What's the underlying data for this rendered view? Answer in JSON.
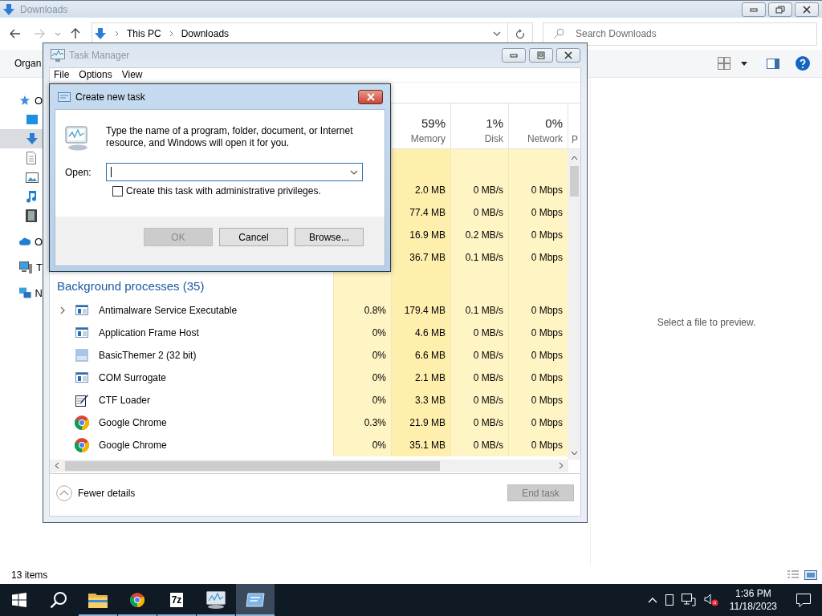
{
  "explorer": {
    "title": "Downloads",
    "path": [
      "This PC",
      "Downloads"
    ],
    "search": {
      "placeholder": "Search Downloads"
    },
    "toolbar_label": "Organ",
    "nav": [
      {
        "kind": "star",
        "label": "O",
        "selected": false,
        "children": [
          {
            "kind": "desktop",
            "selected": false
          },
          {
            "kind": "download",
            "selected": true
          },
          {
            "kind": "document",
            "selected": false
          },
          {
            "kind": "picture",
            "selected": false
          },
          {
            "kind": "music",
            "selected": false
          },
          {
            "kind": "video",
            "selected": false
          }
        ]
      },
      {
        "kind": "cloud",
        "label": "O",
        "selected": false
      },
      {
        "kind": "computer",
        "label": "T",
        "selected": false
      },
      {
        "kind": "network",
        "label": "N",
        "selected": false
      }
    ],
    "preview_message": "Select a file to preview.",
    "status": "13 items"
  },
  "task_manager": {
    "title": "Task Manager",
    "menu": [
      "File",
      "Options",
      "View"
    ],
    "columns": [
      {
        "percent": "59%",
        "label": "Memory"
      },
      {
        "percent": "1%",
        "label": "Disk"
      },
      {
        "percent": "0%",
        "label": "Network"
      }
    ],
    "cut_column": "P",
    "rows": [
      {
        "kind": "blank"
      },
      {
        "kind": "covered",
        "memory": "2.0 MB",
        "disk": "0 MB/s",
        "network": "0 Mbps"
      },
      {
        "kind": "covered",
        "memory": "77.4 MB",
        "disk": "0 MB/s",
        "network": "0 Mbps"
      },
      {
        "kind": "covered",
        "memory": "16.9 MB",
        "disk": "0.2 MB/s",
        "network": "0 Mbps"
      },
      {
        "kind": "covered",
        "memory": "36.7 MB",
        "disk": "0.1 MB/s",
        "network": "0 Mbps"
      },
      {
        "kind": "group",
        "label": "Background processes (35)"
      },
      {
        "kind": "app",
        "name": "Antimalware Service Executable",
        "expandable": true,
        "cpu": "0.8%",
        "memory": "179.4 MB",
        "disk": "0.1 MB/s",
        "network": "0 Mbps"
      },
      {
        "kind": "app",
        "name": "Application Frame Host",
        "expandable": false,
        "cpu": "0%",
        "memory": "4.6 MB",
        "disk": "0 MB/s",
        "network": "0 Mbps"
      },
      {
        "kind": "tile",
        "name": "BasicThemer 2 (32 bit)",
        "expandable": false,
        "cpu": "0%",
        "memory": "6.6 MB",
        "disk": "0 MB/s",
        "network": "0 Mbps"
      },
      {
        "kind": "app",
        "name": "COM Surrogate",
        "expandable": false,
        "cpu": "0%",
        "memory": "2.1 MB",
        "disk": "0 MB/s",
        "network": "0 Mbps"
      },
      {
        "kind": "notepad",
        "name": "CTF Loader",
        "expandable": false,
        "cpu": "0%",
        "memory": "3.3 MB",
        "disk": "0 MB/s",
        "network": "0 Mbps"
      },
      {
        "kind": "browser",
        "name": "Google Chrome",
        "expandable": false,
        "cpu": "0.3%",
        "memory": "21.9 MB",
        "disk": "0 MB/s",
        "network": "0 Mbps"
      },
      {
        "kind": "browser",
        "name": "Google Chrome",
        "expandable": false,
        "cpu": "0%",
        "memory": "35.1 MB",
        "disk": "0 MB/s",
        "network": "0 Mbps"
      }
    ],
    "fewer_details": "Fewer details",
    "end_task": {
      "label": "End task",
      "disabled": true
    }
  },
  "dialog": {
    "title": "Create new task",
    "message": "Type the name of a program, folder, document, or Internet resource, and Windows will open it for you.",
    "open_label": "Open:",
    "admin_checkbox": {
      "label": "Create this task with administrative privileges.",
      "checked": false
    },
    "buttons": [
      {
        "label": "OK",
        "disabled": true
      },
      {
        "label": "Cancel",
        "disabled": false
      },
      {
        "label": "Browse...",
        "disabled": false
      }
    ]
  },
  "taskbar": {
    "apps": [
      {
        "kind": "start",
        "running": false,
        "selected": false
      },
      {
        "kind": "search",
        "running": false,
        "selected": false
      },
      {
        "kind": "folder",
        "running": true,
        "selected": false
      },
      {
        "kind": "browser",
        "running": true,
        "selected": false
      },
      {
        "kind": "archiver",
        "label": "7z",
        "running": true,
        "selected": false
      },
      {
        "kind": "monitor",
        "running": true,
        "selected": false
      },
      {
        "kind": "run",
        "running": true,
        "selected": true
      }
    ],
    "time": "1:36 PM",
    "date": "11/18/2023"
  }
}
